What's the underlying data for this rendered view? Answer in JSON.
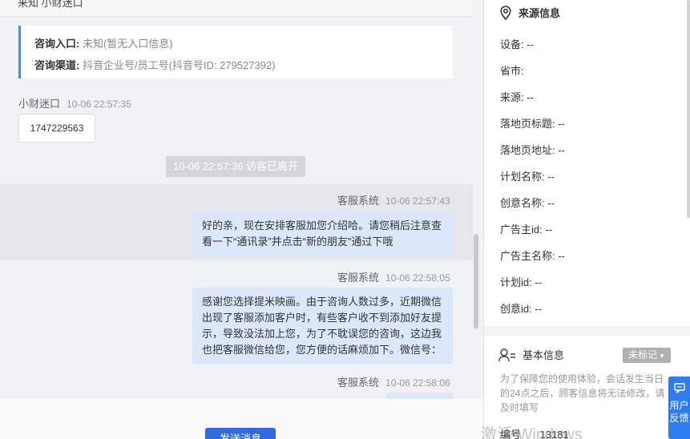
{
  "chat": {
    "top_partial": "来知 小财迷口",
    "info": {
      "entry_label": "咨询入口:",
      "entry_value": "未知(暂无入口信息)",
      "channel_label": "咨询渠道:",
      "channel_value": "抖音企业号/员工号(抖音号ID: 279527392)"
    },
    "visitor": {
      "name": "小财迷口",
      "time": "10-06 22:57:35",
      "message": "1747229563"
    },
    "system_tip": "10-06 22:57:36 访客已离开",
    "messages": [
      {
        "sender": "客服系统",
        "time": "10-06 22:57:43",
        "text": "好的亲，现在安排客服加您介绍哈。请您稍后注意查看一下“通讯录”并点击“新的朋友”通过下哦"
      },
      {
        "sender": "客服系统",
        "time": "10-06 22:58:05",
        "text": "感谢您选择提米映画。由于咨询人数过多，近期微信出现了客服添加客户时，有些客户收不到添加好友提示，导致没法加上您，为了不耽误您的咨询，这边我也把客服微信给您，您方便的话麻烦加下。微信号："
      },
      {
        "sender": "客服系统",
        "time": "10-06 22:58:06",
        "text": ""
      }
    ],
    "send_label": "发送消息"
  },
  "side": {
    "source_title": "来源信息",
    "fields": [
      {
        "label": "设备:",
        "value": "--"
      },
      {
        "label": "省市:",
        "value": ""
      },
      {
        "label": "来源:",
        "value": "--"
      },
      {
        "label": "落地页标题:",
        "value": "--"
      },
      {
        "label": "落地页地址:",
        "value": "--"
      },
      {
        "label": "计划名称:",
        "value": "--"
      },
      {
        "label": "创意名称:",
        "value": "--"
      },
      {
        "label": "广告主id:",
        "value": "--"
      },
      {
        "label": "广告主名称:",
        "value": "--"
      },
      {
        "label": "计划id:",
        "value": "--"
      },
      {
        "label": "创意id:",
        "value": "--"
      }
    ],
    "basic_title": "基本信息",
    "tag_label": "未标记",
    "notice": "为了保障您的使用体验，会话发生当日的24点之后，顾客信息将无法修改，请及时填写",
    "number_label": "编号",
    "number_value": "13181"
  },
  "feedback_label": "用户反馈",
  "watermark": "激活 Windows",
  "colors": {
    "accent": "#2f6bd9",
    "bubble": "#dbe8fb",
    "card_border": "#3f8cf5",
    "feedback": "#2f7cf0"
  },
  "icons": [
    "location-pin-icon",
    "user-info-icon",
    "chevron-down-icon",
    "feedback-chat-icon"
  ]
}
